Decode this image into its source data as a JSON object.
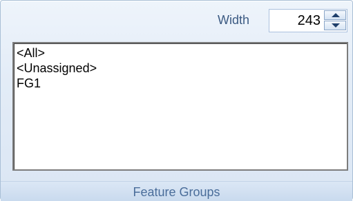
{
  "width_control": {
    "label": "Width",
    "value": "243"
  },
  "list": {
    "items": [
      {
        "label": "<All>"
      },
      {
        "label": "<Unassigned>"
      },
      {
        "label": "FG1"
      }
    ]
  },
  "group": {
    "title": "Feature Groups"
  }
}
